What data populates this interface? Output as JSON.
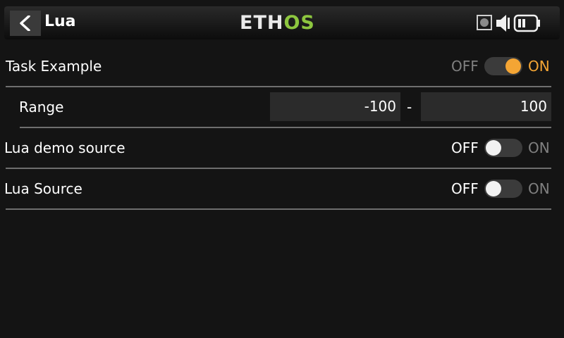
{
  "header": {
    "title": "Lua",
    "logo": {
      "left": "ETH",
      "right": "OS"
    },
    "icons": [
      "back-icon",
      "sd-card-icon",
      "speaker-icon",
      "battery-icon"
    ]
  },
  "rows": {
    "task_example": {
      "label": "Task Example",
      "off_label": "OFF",
      "on_label": "ON",
      "value": "ON"
    },
    "range": {
      "label": "Range",
      "min": "-100",
      "separator": "-",
      "max": "100"
    },
    "lua_demo_source": {
      "label": "Lua demo source",
      "off_label": "OFF",
      "on_label": "ON",
      "value": "OFF"
    },
    "lua_source": {
      "label": "Lua Source",
      "off_label": "OFF",
      "on_label": "ON",
      "value": "OFF"
    }
  },
  "colors": {
    "accent_on": "#f4a534",
    "inactive_text": "#808080",
    "logo_green": "#8dc63f"
  }
}
